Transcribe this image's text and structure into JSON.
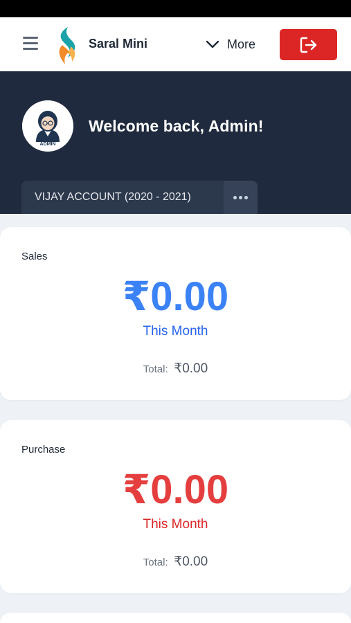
{
  "app": {
    "brand": "Saral Mini",
    "more_label": "More"
  },
  "hero": {
    "welcome": "Welcome back, Admin!",
    "avatar_label": "ADMIN",
    "account": "VIJAY ACCOUNT (2020 - 2021)"
  },
  "cards": [
    {
      "title": "Sales",
      "amount": "₹0.00",
      "period": "This Month",
      "total_label": "Total:",
      "total_value": "₹0.00",
      "accent": "#3b82f6"
    },
    {
      "title": "Purchase",
      "amount": "₹0.00",
      "period": "This Month",
      "total_label": "Total:",
      "total_value": "₹0.00",
      "accent": "#e53e3e"
    }
  ],
  "colors": {
    "hero_bg": "#1f2a3e",
    "logout_bg": "#dc2626",
    "sales_accent": "#3b82f6",
    "purchase_accent": "#e53e3e"
  },
  "icons": [
    "menu-icon",
    "logo-icon",
    "chevron-down-icon",
    "logout-icon",
    "avatar-icon",
    "more-dots-icon"
  ]
}
